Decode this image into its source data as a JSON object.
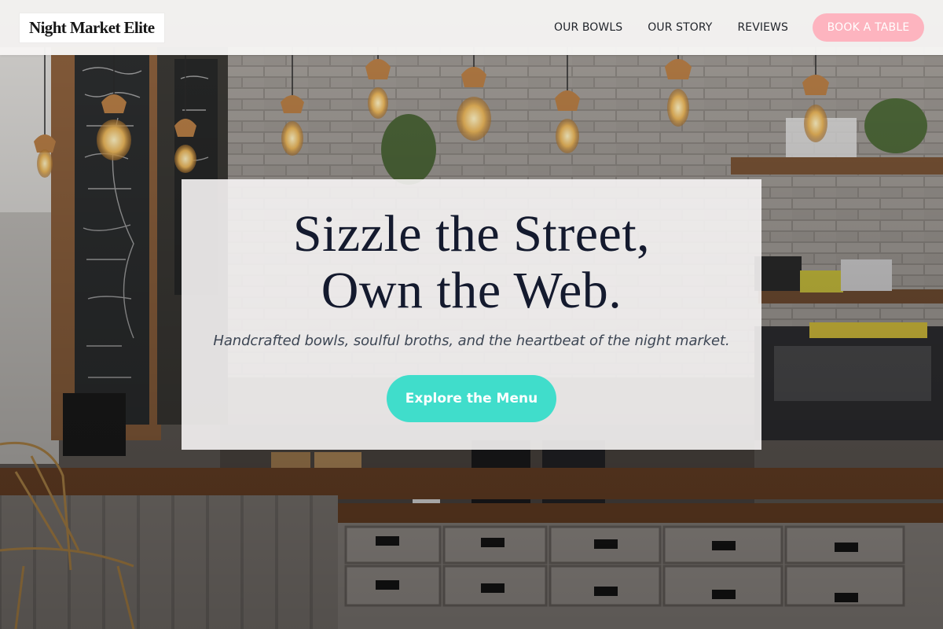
{
  "brand": {
    "name": "Night Market Elite"
  },
  "nav": {
    "items": [
      {
        "label": "OUR BOWLS"
      },
      {
        "label": "OUR STORY"
      },
      {
        "label": "REVIEWS"
      }
    ],
    "cta_label": "BOOK A TABLE"
  },
  "hero": {
    "title_line1": "Sizzle the Street,",
    "title_line2": "Own the Web.",
    "subtitle": "Handcrafted bowls, soulful broths, and the heartbeat of the night market.",
    "button_label": "Explore the Menu"
  },
  "colors": {
    "header_bg": "#f6f5f4",
    "book_button": "#fdb4bf",
    "cta_button": "#40ddcb",
    "title_text": "#141a2e"
  },
  "background": {
    "description_icon": "cafe-interior-photo"
  }
}
